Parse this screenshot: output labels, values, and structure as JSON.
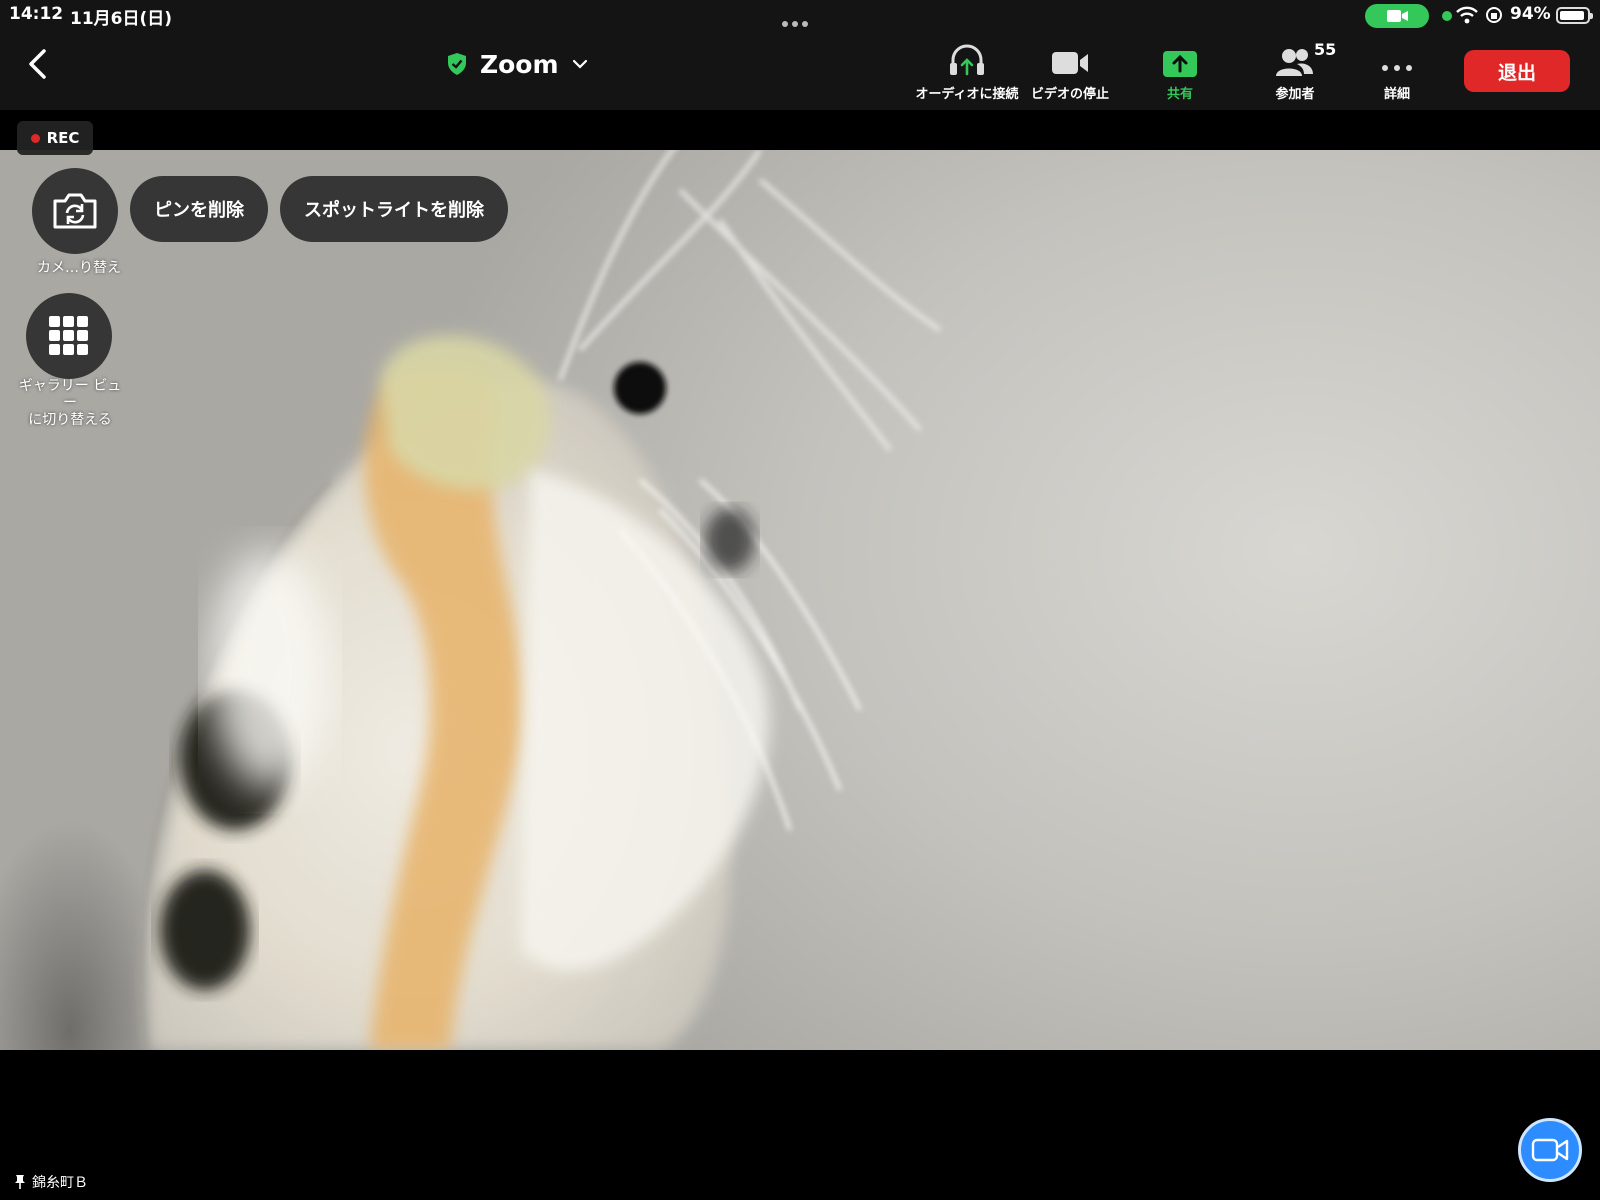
{
  "status_bar": {
    "time": "14:12",
    "date": "11月6日(日)",
    "battery": "94%",
    "battery_level": 0.94
  },
  "header": {
    "title": "Zoom",
    "audio_label": "オーディオに接続",
    "video_label": "ビデオの停止",
    "share_label": "共有",
    "participants_label": "参加者",
    "participants_count": "55",
    "more_label": "詳細",
    "leave_label": "退出"
  },
  "video": {
    "rec_label": "REC",
    "switch_camera_label": "カメ…り替え",
    "gallery_label": "ギャラリー ビュー\nに切り替える",
    "unpin_label": "ピンを削除",
    "unspotlight_label": "スポットライトを削除",
    "speaker_name": "錦糸町Ｂ"
  },
  "colors": {
    "accent_green": "#34c759",
    "leave_red": "#e02828",
    "zoom_blue": "#2d8cff"
  }
}
